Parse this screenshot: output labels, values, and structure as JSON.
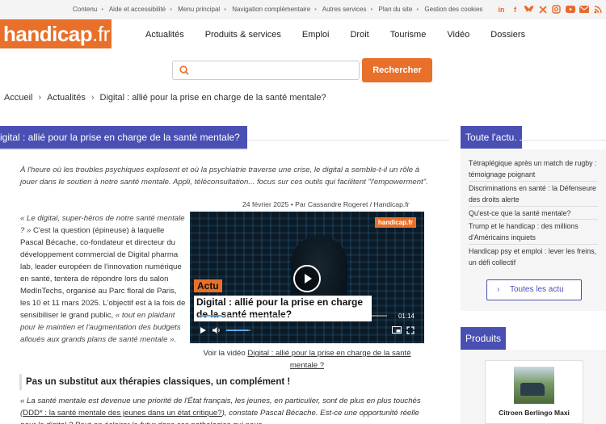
{
  "topbar": {
    "links": [
      "Contenu",
      "Aide et accessibilité",
      "Menu principal",
      "Navigation complémentaire",
      "Autres services",
      "Plan du site",
      "Gestion des cookies"
    ],
    "social_icons": [
      "linkedin-icon",
      "facebook-icon",
      "bluesky-icon",
      "x-icon",
      "instagram-icon",
      "youtube-icon",
      "email-icon",
      "rss-icon"
    ]
  },
  "header": {
    "logo_main": "handicap",
    "logo_ext": ".fr",
    "nav": [
      "Actualités",
      "Produits & services",
      "Emploi",
      "Droit",
      "Tourisme",
      "Vidéo",
      "Dossiers"
    ]
  },
  "search": {
    "placeholder": "",
    "button_label": "Rechercher"
  },
  "breadcrumb": [
    "Accueil",
    "Actualités",
    "Digital : allié pour la prise en charge de la santé mentale?"
  ],
  "article": {
    "title": "igital : allié pour la prise en charge de la santé mentale?",
    "intro": "À l'heure où les troubles psychiques explosent et où la psychiatrie traverse une crise, le digital a semble-t-il un rôle à jouer dans le soutien à notre santé mentale. Appli, téléconsultation... focus sur ces outils qui facilitent \"l'empowerment\".",
    "byline": "24 février 2025 • Par Cassandre Rogeret / Handicap.fr",
    "body_quote": "« Le digital, super-héros de notre santé mentale ? »",
    "body_text": " C'est la question (épineuse) à laquelle Pascal Bécache, co-fondateur et directeur du développement commercial de Digital pharma lab, leader européen de l'innovation numérique en santé, tentera de répondre lors du salon MedInTechs, organisé au Parc floral de Paris, les 10 et 11 mars 2025. L'objectif est à la fois de sensibiliser le grand public, ",
    "body_italic": "« tout en plaidant pour le maintien et l'augmentation des budgets alloués aux grands plans de santé mentale ».",
    "video": {
      "logo": "handicap.fr",
      "tag": "Actu",
      "caption": "Digital : allié pour la prise en charge de la santé mentale?",
      "time": "01:14",
      "progress": 0.12,
      "volume": 0.9,
      "link_prefix": "Voir la vidéo ",
      "link_text": "Digital : allié pour la prise en charge de la santé mentale ?"
    },
    "subheading": "Pas un substitut aux thérapies classiques, un complément !",
    "quote_start": "« La santé mentale est devenue une priorité de l'État français, les jeunes, en particulier, sont de plus en plus touchés (",
    "quote_link": "DDD* : la santé mentale des jeunes dans un état critique?",
    "quote_mid": "), constate Pascal Bécache. Est-ce une opportunité réelle pour le digital ? Peut-on éclairer le futur dans ces pathologies qui nous"
  },
  "sidebar": {
    "news_title": "Toute l'actu.",
    "news": [
      "Tétraplégique après un match de rugby : témoignage poignant",
      "Discriminations en santé : la Défenseure des droits alerte",
      "Qu'est-ce que la santé mentale?",
      "Trump et le handicap : des millions d'Américains inquiets",
      "Handicap psy et emploi : lever les freins, un défi collectif"
    ],
    "all_news_label": "Toutes les actu",
    "products_title": "Produits",
    "product_name": "Citroen Berlingo Maxi"
  }
}
